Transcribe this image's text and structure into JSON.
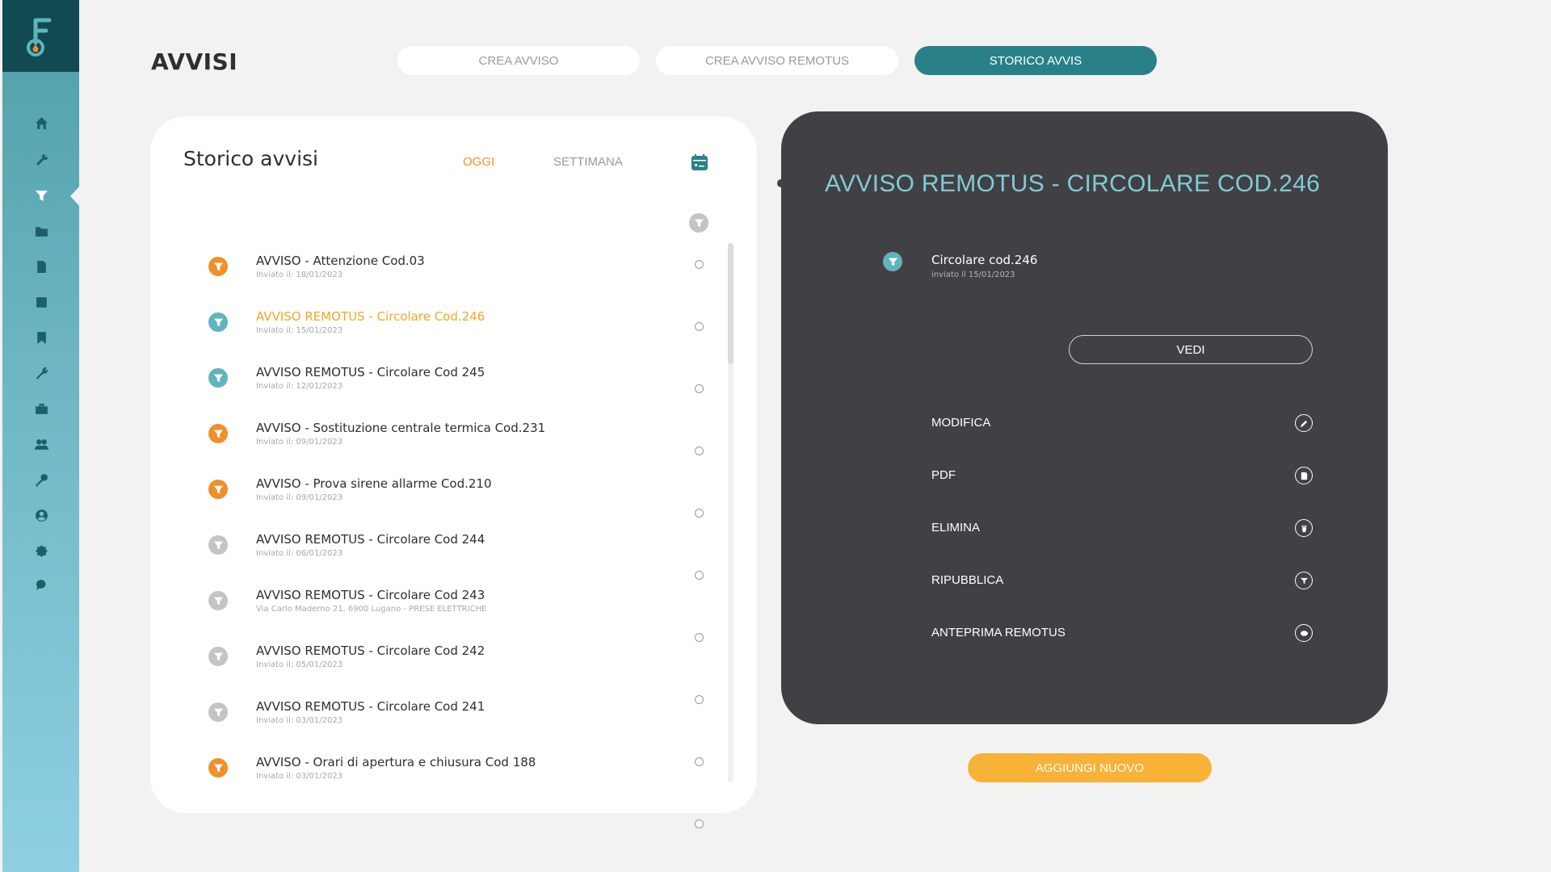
{
  "header": {
    "title": "AVVISI",
    "tabs": [
      {
        "label": "CREA AVVISO",
        "active": false
      },
      {
        "label": "CREA AVVISO REMOTUS",
        "active": false
      },
      {
        "label": "STORICO AVVIS",
        "active": true
      }
    ]
  },
  "sidebar": {
    "logo_letter": "F",
    "items": [
      {
        "icon": "home-icon"
      },
      {
        "icon": "tools-icon"
      },
      {
        "icon": "funnel-icon",
        "active": true
      },
      {
        "icon": "folder-icon"
      },
      {
        "icon": "document-icon"
      },
      {
        "icon": "square-icon"
      },
      {
        "icon": "bookmark-icon"
      },
      {
        "icon": "wrench-icon"
      },
      {
        "icon": "briefcase-icon"
      },
      {
        "icon": "users-icon"
      },
      {
        "icon": "key-icon"
      },
      {
        "icon": "account-icon"
      },
      {
        "icon": "settings-icon"
      },
      {
        "icon": "chat-icon"
      }
    ]
  },
  "history": {
    "title": "Storico avvisi",
    "filter_today": "OGGI",
    "filter_week": "SETTIMANA",
    "items": [
      {
        "title": "AVVISO - Attenzione Cod.03",
        "subtitle": "Inviato il: 18/01/2023",
        "kind": "orange",
        "highlighted": false
      },
      {
        "title": "AVVISO REMOTUS - Circolare Cod.246",
        "subtitle": "Inviato il: 15/01/2023",
        "kind": "teal",
        "highlighted": true
      },
      {
        "title": "AVVISO REMOTUS - Circolare Cod 245",
        "subtitle": "Inviato il: 12/01/2023",
        "kind": "teal",
        "highlighted": false
      },
      {
        "title": "AVVISO - Sostituzione centrale termica Cod.231",
        "subtitle": "Inviato il: 09/01/2023",
        "kind": "orange",
        "highlighted": false
      },
      {
        "title": "AVVISO - Prova sirene allarme Cod.210",
        "subtitle": "Inviato il: 09/01/2023",
        "kind": "orange",
        "highlighted": false
      },
      {
        "title": "AVVISO REMOTUS - Circolare Cod 244",
        "subtitle": "Inviato il: 06/01/2023",
        "kind": "grey",
        "highlighted": false
      },
      {
        "title": "AVVISO REMOTUS - Circolare Cod 243",
        "subtitle": "Via Carlo Maderno 21, 6900 Lugano - PRESE ELETTRICHE",
        "kind": "grey",
        "highlighted": false
      },
      {
        "title": "AVVISO REMOTUS - Circolare Cod 242",
        "subtitle": "Inviato il: 05/01/2023",
        "kind": "grey",
        "highlighted": false
      },
      {
        "title": "AVVISO REMOTUS - Circolare Cod 241",
        "subtitle": "Inviato il: 03/01/2023",
        "kind": "grey",
        "highlighted": false
      },
      {
        "title": "AVVISO - Orari di apertura e chiusura Cod 188",
        "subtitle": "Inviato il: 03/01/2023",
        "kind": "orange",
        "highlighted": false
      }
    ]
  },
  "detail": {
    "title": "AVVISO REMOTUS - CIRCOLARE COD.246",
    "name": "Circolare cod.246",
    "date": "inviato il 15/01/2023",
    "view_label": "VEDI",
    "actions": [
      {
        "label": "MODIFICA",
        "icon": "pencil-icon"
      },
      {
        "label": "PDF",
        "icon": "pdf-icon"
      },
      {
        "label": "ELIMINA",
        "icon": "trash-icon"
      },
      {
        "label": "RIPUBBLICA",
        "icon": "funnel-icon"
      },
      {
        "label": "ANTEPRIMA REMOTUS",
        "icon": "eye-icon"
      }
    ]
  },
  "add_button_label": "AGGIUNGI NUOVO",
  "colors": {
    "teal": "#2a8088",
    "orange": "#f0902a",
    "teal_light": "#5fb4be",
    "grey": "#c4c4c4",
    "highlight_text": "#f5a623",
    "panel_dark": "#414045",
    "add_button": "#f8b237"
  }
}
